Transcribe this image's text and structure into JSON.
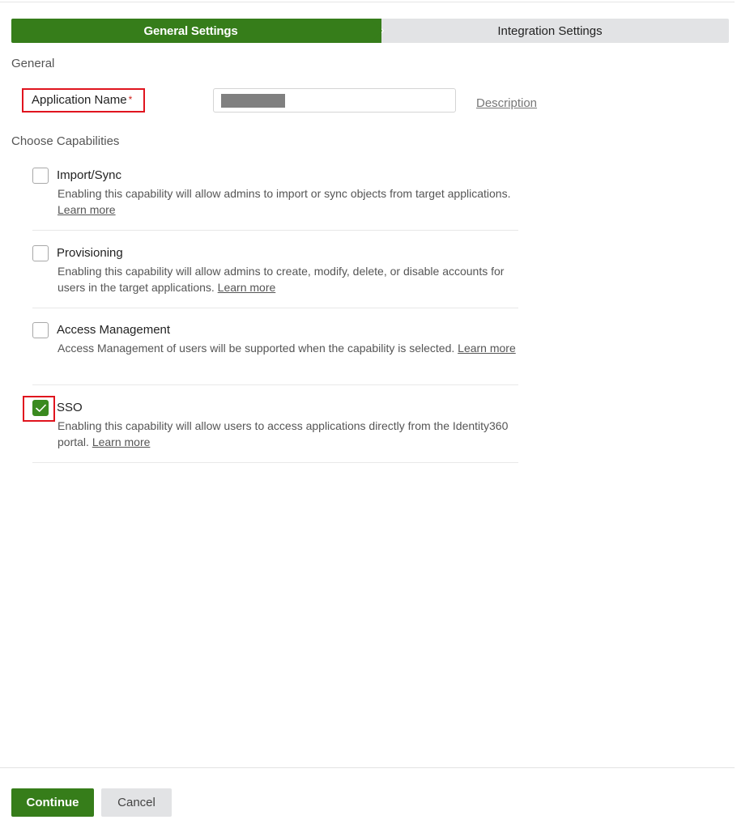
{
  "stepper": {
    "steps": [
      {
        "label": "General Settings",
        "state": "active"
      },
      {
        "label": "Integration Settings",
        "state": "inactive"
      }
    ],
    "active_color": "#367d1a",
    "inactive_color": "#e2e3e5"
  },
  "general": {
    "section_label": "General",
    "app_name": {
      "label": "Application Name",
      "required_marker": "*",
      "value": "",
      "value_redacted": true
    },
    "description_link": "Description"
  },
  "capabilities": {
    "section_label": "Choose Capabilities",
    "items": [
      {
        "title": "Import/Sync",
        "description": "Enabling this capability will allow admins to import or sync objects from target applications.",
        "link": "Learn more",
        "checked": false
      },
      {
        "title": "Provisioning",
        "description": "Enabling this capability will allow admins to create, modify, delete, or disable accounts for users in the target applications.",
        "link": "Learn more",
        "checked": false
      },
      {
        "title": "Access Management",
        "description": "Access Management of users will be supported when the capability is selected.",
        "link": "Learn more",
        "checked": false
      },
      {
        "title": "SSO",
        "description": "Enabling this capability will allow users to access applications directly from the Identity360 portal.",
        "link": "Learn more",
        "checked": true
      }
    ]
  },
  "annotations": {
    "highlight_color": "#e0141e"
  },
  "footer": {
    "continue_label": "Continue",
    "cancel_label": "Cancel"
  }
}
